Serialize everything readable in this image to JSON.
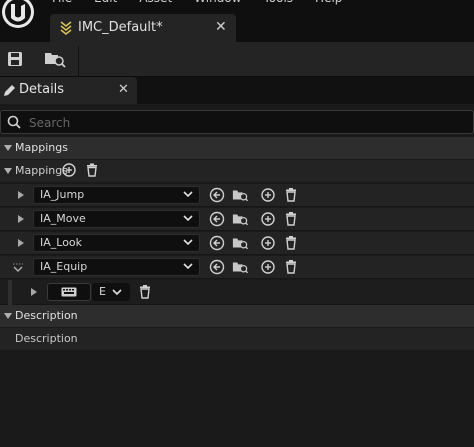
{
  "menu": [
    "File",
    "Edit",
    "Asset",
    "Window",
    "Tools",
    "Help"
  ],
  "document_tab": {
    "title": "IMC_Default*"
  },
  "details_tab": {
    "title": "Details"
  },
  "search": {
    "placeholder": "Search"
  },
  "sections": {
    "mappings": {
      "label": "Mappings"
    },
    "description": {
      "label": "Description"
    }
  },
  "mappings_row": {
    "label": "Mappings"
  },
  "mappings": [
    {
      "action": "IA_Jump"
    },
    {
      "action": "IA_Move"
    },
    {
      "action": "IA_Look"
    },
    {
      "action": "IA_Equip"
    }
  ],
  "key_binding": {
    "key": "E"
  },
  "description_row": {
    "label": "Description"
  },
  "colors": {
    "panel": "#1a1a1a",
    "category": "#2d2d2d",
    "field": "#0f0f0f"
  }
}
